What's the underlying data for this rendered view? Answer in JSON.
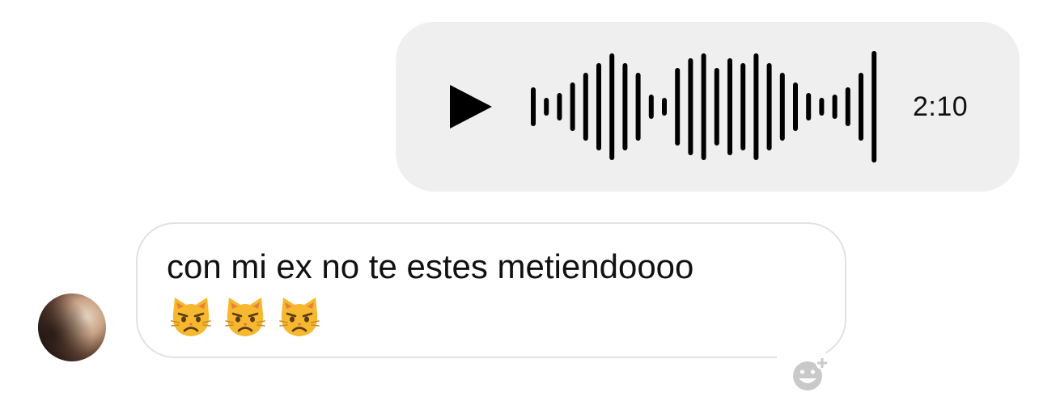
{
  "conversation": {
    "voice_message": {
      "direction": "outgoing",
      "duration": "2:10",
      "play_icon": "play-icon",
      "bubble_color": "#efefef"
    },
    "text_message": {
      "direction": "incoming",
      "text": "con mi ex no te estes metiendoooo",
      "emoji": [
        "😾",
        "😾",
        "😾"
      ],
      "avatar_icon": "avatar",
      "react_icon": "add-reaction-icon"
    }
  }
}
